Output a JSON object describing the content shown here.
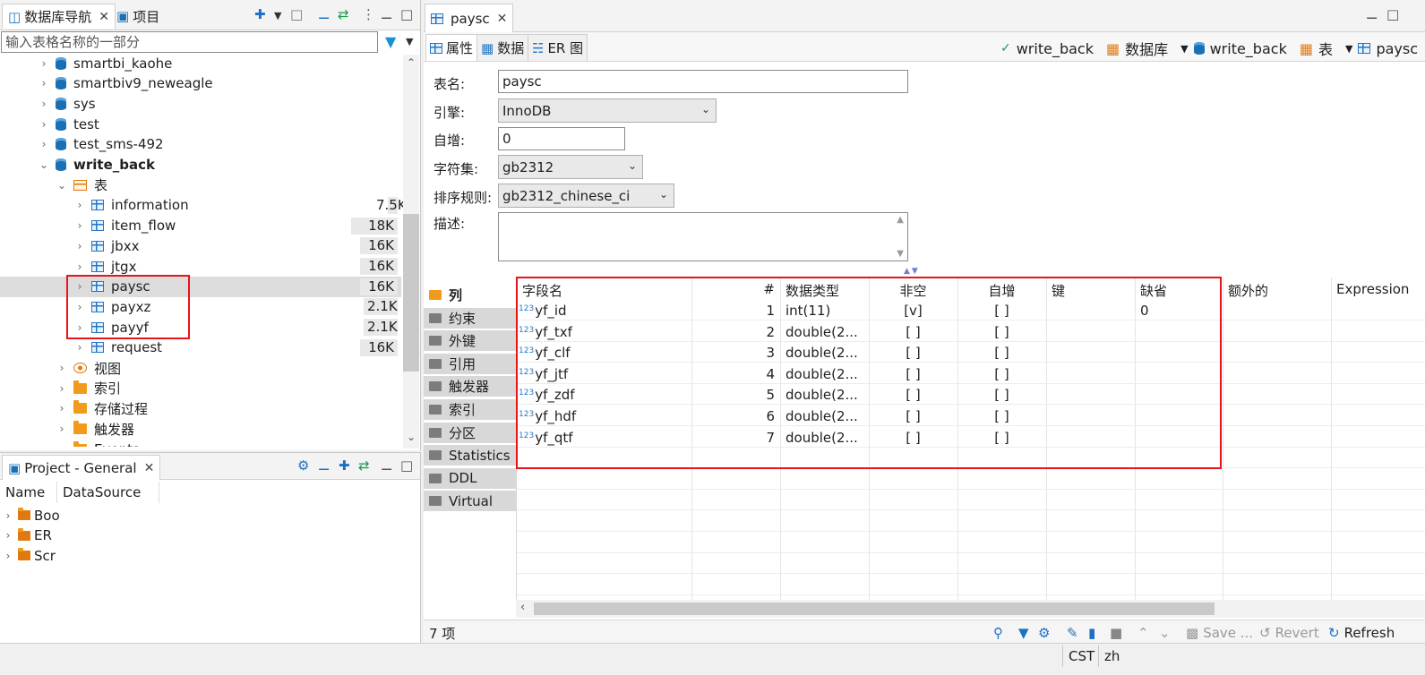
{
  "navigator": {
    "tab_db_nav": "数据库导航",
    "tab_project": "项目",
    "filter_placeholder": "输入表格名称的一部分",
    "tree": [
      {
        "label": "smartbi_kaohe",
        "type": "db",
        "level": 1,
        "expand": ">"
      },
      {
        "label": "smartbiv9_neweagle",
        "type": "db",
        "level": 1,
        "expand": ">"
      },
      {
        "label": "sys",
        "type": "db",
        "level": 1,
        "expand": ">"
      },
      {
        "label": "test",
        "type": "db",
        "level": 1,
        "expand": ">"
      },
      {
        "label": "test_sms-492",
        "type": "db",
        "level": 1,
        "expand": ">"
      },
      {
        "label": "write_back",
        "type": "db",
        "level": 1,
        "expand": "v",
        "bold": true
      },
      {
        "label": "表",
        "type": "tables",
        "level": 2,
        "expand": "v"
      },
      {
        "label": "information",
        "type": "table",
        "level": 3,
        "expand": ">",
        "size": "7.5K"
      },
      {
        "label": "item_flow",
        "type": "table",
        "level": 3,
        "expand": ">",
        "size": "18K"
      },
      {
        "label": "jbxx",
        "type": "table",
        "level": 3,
        "expand": ">",
        "size": "16K"
      },
      {
        "label": "jtgx",
        "type": "table",
        "level": 3,
        "expand": ">",
        "size": "16K"
      },
      {
        "label": "paysc",
        "type": "table",
        "level": 3,
        "expand": ">",
        "size": "16K",
        "selected": true
      },
      {
        "label": "payxz",
        "type": "table",
        "level": 3,
        "expand": ">",
        "size": "2.1K"
      },
      {
        "label": "payyf",
        "type": "table",
        "level": 3,
        "expand": ">",
        "size": "2.1K"
      },
      {
        "label": "request",
        "type": "table",
        "level": 3,
        "expand": ">",
        "size": "16K"
      },
      {
        "label": "视图",
        "type": "view",
        "level": 2,
        "expand": ">"
      },
      {
        "label": "索引",
        "type": "folder",
        "level": 2,
        "expand": ">"
      },
      {
        "label": "存储过程",
        "type": "folder",
        "level": 2,
        "expand": ">"
      },
      {
        "label": "触发器",
        "type": "folder",
        "level": 2,
        "expand": ">"
      },
      {
        "label": "Events",
        "type": "folder",
        "level": 2,
        "expand": ">"
      }
    ]
  },
  "project": {
    "title": "Project - General",
    "col_name": "Name",
    "col_datasource": "DataSource",
    "items": [
      "Boo",
      "ER",
      "Scr"
    ]
  },
  "editor": {
    "tab_title": "paysc",
    "subtabs": [
      "属性",
      "数据",
      "ER 图"
    ],
    "crumbs": {
      "conn": "write_back",
      "db_type": "数据库",
      "db": "write_back",
      "obj_type": "表",
      "obj": "paysc"
    },
    "props": {
      "name_label": "表名:",
      "name_value": "paysc",
      "engine_label": "引擎:",
      "engine_value": "InnoDB",
      "autoinc_label": "自增:",
      "autoinc_value": "0",
      "charset_label": "字符集:",
      "charset_value": "gb2312",
      "collation_label": "排序规则:",
      "collation_value": "gb2312_chinese_ci",
      "desc_label": "描述:"
    },
    "side_tabs": [
      "列",
      "约束",
      "外键",
      "引用",
      "触发器",
      "索引",
      "分区",
      "Statistics",
      "DDL",
      "Virtual"
    ],
    "columns_header": [
      "字段名",
      "#",
      "数据类型",
      "非空",
      "自增",
      "键",
      "缺省",
      "额外的",
      "Expression"
    ],
    "rows": [
      {
        "name": "yf_id",
        "num": "1",
        "type": "int(11)",
        "notnull": "[v]",
        "autoinc": "[ ]",
        "key": "",
        "default": "0"
      },
      {
        "name": "yf_txf",
        "num": "2",
        "type": "double(2...",
        "notnull": "[ ]",
        "autoinc": "[ ]",
        "key": "",
        "default": ""
      },
      {
        "name": "yf_clf",
        "num": "3",
        "type": "double(2...",
        "notnull": "[ ]",
        "autoinc": "[ ]",
        "key": "",
        "default": ""
      },
      {
        "name": "yf_jtf",
        "num": "4",
        "type": "double(2...",
        "notnull": "[ ]",
        "autoinc": "[ ]",
        "key": "",
        "default": ""
      },
      {
        "name": "yf_zdf",
        "num": "5",
        "type": "double(2...",
        "notnull": "[ ]",
        "autoinc": "[ ]",
        "key": "",
        "default": ""
      },
      {
        "name": "yf_hdf",
        "num": "6",
        "type": "double(2...",
        "notnull": "[ ]",
        "autoinc": "[ ]",
        "key": "",
        "default": ""
      },
      {
        "name": "yf_qtf",
        "num": "7",
        "type": "double(2...",
        "notnull": "[ ]",
        "autoinc": "[ ]",
        "key": "",
        "default": ""
      }
    ],
    "item_count": "7 项",
    "save_label": "Save ...",
    "revert_label": "Revert",
    "refresh_label": "Refresh"
  },
  "status": {
    "timezone": "CST",
    "locale": "zh"
  },
  "colors": {
    "accent": "#1e6fc4",
    "highlight_box": "#e8141a",
    "folder": "#f29a1b"
  }
}
